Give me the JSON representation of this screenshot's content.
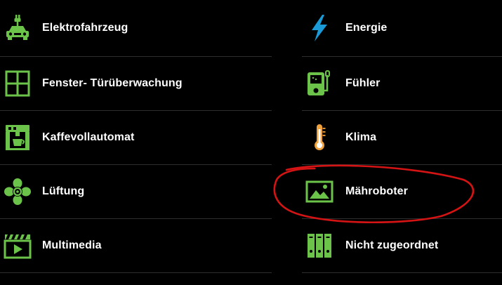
{
  "colors": {
    "background": "#000000",
    "icon_green": "#6cc34a",
    "energy_blue": "#1a9bd7",
    "thermo_orange": "#f0a23c",
    "text": "#ffffff",
    "divider": "#2e2e2e",
    "annotation_red": "#d41414"
  },
  "left_items": [
    {
      "label": "Elektrofahrzeug",
      "icon": "electric-car-icon"
    },
    {
      "label": "Fenster- Türüberwachung",
      "icon": "window-icon"
    },
    {
      "label": "Kaffevollautomat",
      "icon": "coffee-machine-icon"
    },
    {
      "label": "Lüftung",
      "icon": "fan-icon"
    },
    {
      "label": "Multimedia",
      "icon": "clapperboard-icon"
    }
  ],
  "right_items": [
    {
      "label": "Energie",
      "icon": "lightning-bolt-icon"
    },
    {
      "label": "Fühler",
      "icon": "sensor-icon"
    },
    {
      "label": "Klima",
      "icon": "thermometer-icon"
    },
    {
      "label": "Mähroboter",
      "icon": "image-icon"
    },
    {
      "label": "Nicht zugeordnet",
      "icon": "binders-icon"
    }
  ]
}
